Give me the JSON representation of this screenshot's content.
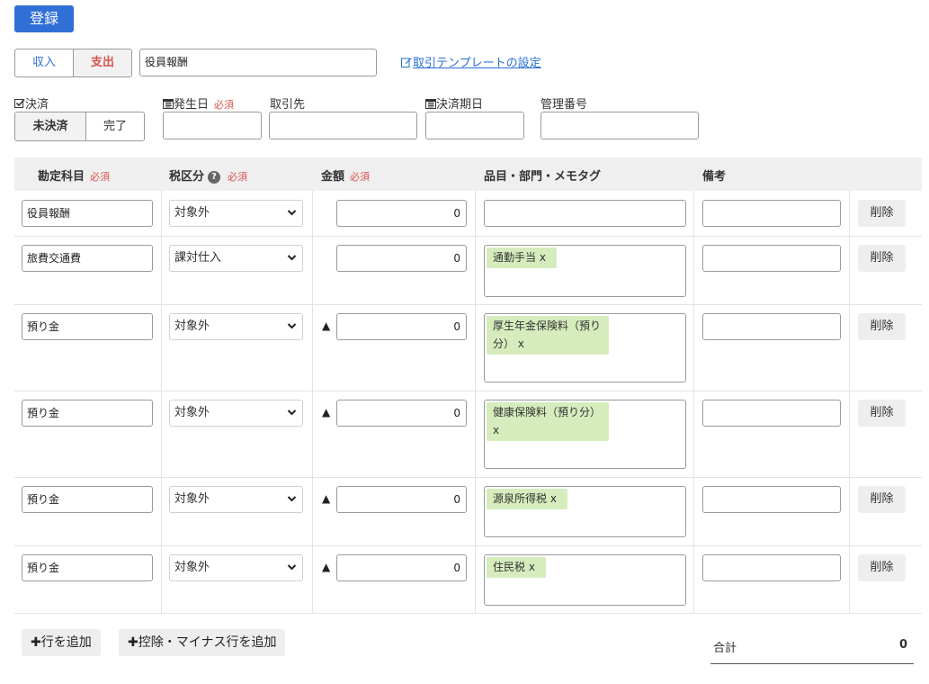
{
  "toolbar": {
    "register_label": "登録"
  },
  "type_toggle": {
    "income": "収入",
    "expense": "支出",
    "selected": "expense"
  },
  "title_field": {
    "value": "役員報酬"
  },
  "template_link": "取引テンプレートの設定",
  "settlement": {
    "label": "決済",
    "unsettled": "未決済",
    "done": "完了",
    "selected": "unsettled"
  },
  "fields": {
    "issue_date": {
      "label": "発生日",
      "required": "必須",
      "value": ""
    },
    "partner": {
      "label": "取引先",
      "value": ""
    },
    "due_date": {
      "label": "決済期日",
      "value": ""
    },
    "mgmt_no": {
      "label": "管理番号",
      "value": ""
    }
  },
  "table": {
    "headers": {
      "account": "勘定科目",
      "tax": "税区分",
      "amount": "金額",
      "tags": "品目・部門・メモタグ",
      "note": "備考",
      "required": "必須"
    },
    "rows": [
      {
        "account": "役員報酬",
        "tax": "対象外",
        "minus": false,
        "amount": "0",
        "tags": "",
        "note": "",
        "delete": "削除"
      },
      {
        "account": "旅費交通費",
        "tax": "課対仕入",
        "minus": false,
        "amount": "0",
        "tags": "通勤手当 x",
        "note": "",
        "delete": "削除"
      },
      {
        "account": "預り金",
        "tax": "対象外",
        "minus": true,
        "amount": "0",
        "tags": "厚生年金保険料（預り分） x",
        "note": "",
        "delete": "削除"
      },
      {
        "account": "預り金",
        "tax": "対象外",
        "minus": true,
        "amount": "0",
        "tags": "健康保険料（預り分） x",
        "note": "",
        "delete": "削除"
      },
      {
        "account": "預り金",
        "tax": "対象外",
        "minus": true,
        "amount": "0",
        "tags": "源泉所得税 x",
        "note": "",
        "delete": "削除"
      },
      {
        "account": "預り金",
        "tax": "対象外",
        "minus": true,
        "amount": "0",
        "tags": "住民税 x",
        "note": "",
        "delete": "削除"
      }
    ],
    "minus_symbol": "▲"
  },
  "actions": {
    "add_row": "行を追加",
    "add_minus_row": "控除・マイナス行を追加"
  },
  "total": {
    "label": "合計",
    "value": "0"
  },
  "colors": {
    "primary": "#2f6fd6",
    "expense": "#d9534f",
    "tag_bg": "#d6ecbd"
  }
}
